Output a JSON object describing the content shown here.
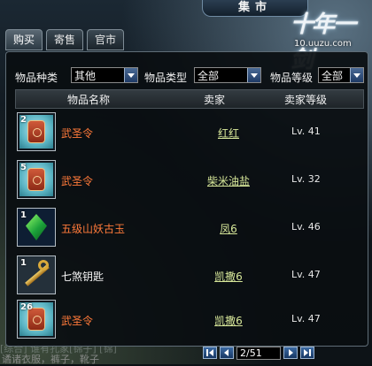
{
  "window": {
    "title": "集市"
  },
  "logo": {
    "text": "十年一剑"
  },
  "watermark": "10.uuzu.com",
  "tabs": [
    {
      "label": "购买"
    },
    {
      "label": "寄售"
    },
    {
      "label": "官市"
    }
  ],
  "filters": {
    "category": {
      "label": "物品种类",
      "value": "其他"
    },
    "type": {
      "label": "物品类型",
      "value": "全部"
    },
    "level": {
      "label": "物品等级",
      "value": "全部"
    }
  },
  "table": {
    "columns": [
      "物品名称",
      "卖家",
      "卖家等级"
    ],
    "rows": [
      {
        "qty": "2",
        "icon": "token-icon",
        "name": "武圣令",
        "seller": "红红",
        "level": "Lv. 41"
      },
      {
        "qty": "5",
        "icon": "token-icon",
        "name": "武圣令",
        "seller": "柴米油盐",
        "level": "Lv. 32"
      },
      {
        "qty": "1",
        "icon": "jade-icon",
        "name": "五级山妖古玉",
        "seller": "凤6",
        "level": "Lv. 46"
      },
      {
        "qty": "1",
        "icon": "key-icon",
        "name": "七煞钥匙",
        "seller": "凯撒6",
        "level": "Lv. 47"
      },
      {
        "qty": "26",
        "icon": "token-icon",
        "name": "武圣令",
        "seller": "凯撒6",
        "level": "Lv. 47"
      }
    ]
  },
  "pagination": {
    "value": "2/51"
  },
  "chat": {
    "line1": "[综合] 谁有孔家[锦子] [锦]",
    "line2": "谲诸衣服，裤子，靴子"
  },
  "colors": {
    "item_orange": "#ff7a3a",
    "seller_link": "#d8e89a",
    "button_blue": "#1f3a66"
  }
}
